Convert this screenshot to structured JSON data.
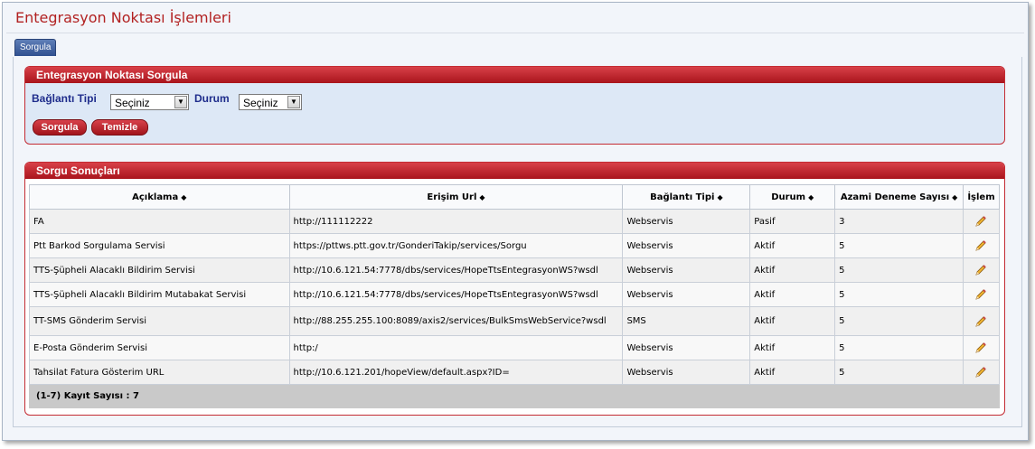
{
  "page": {
    "title": "Entegrasyon Noktası İşlemleri",
    "tab": "Sorgula"
  },
  "query_panel": {
    "header": "Entegrasyon Noktası Sorgula",
    "connection_type": {
      "label": "Bağlantı Tipi",
      "value": "Seçiniz"
    },
    "status": {
      "label": "Durum",
      "value": "Seçiniz"
    },
    "search_button": "Sorgula",
    "clear_button": "Temizle"
  },
  "results_panel": {
    "header": "Sorgu Sonuçları",
    "columns": [
      "Açıklama",
      "Erişim Url",
      "Bağlantı Tipi",
      "Durum",
      "Azami Deneme Sayısı",
      "İşlem"
    ],
    "rows": [
      {
        "description": "FA",
        "url": "http://111112222",
        "type": "Webservis",
        "status": "Pasif",
        "attempts": "3"
      },
      {
        "description": "Ptt Barkod Sorgulama Servisi",
        "url": "https://pttws.ptt.gov.tr/GonderiTakip/services/Sorgu",
        "type": "Webservis",
        "status": "Aktif",
        "attempts": "5"
      },
      {
        "description": "TTS-Şüpheli Alacaklı Bildirim Servisi",
        "url": "http://10.6.121.54:7778/dbs/services/HopeTtsEntegrasyonWS?wsdl",
        "type": "Webservis",
        "status": "Aktif",
        "attempts": "5"
      },
      {
        "description": "TTS-Şüpheli Alacaklı Bildirim Mutabakat Servisi",
        "url": "http://10.6.121.54:7778/dbs/services/HopeTtsEntegrasyonWS?wsdl",
        "type": "Webservis",
        "status": "Aktif",
        "attempts": "5"
      },
      {
        "description": "TT-SMS Gönderim Servisi",
        "url": "http://88.255.255.100:8089/axis2/services/BulkSmsWebService?wsdl",
        "type": "SMS",
        "status": "Aktif",
        "attempts": "5"
      },
      {
        "description": "E-Posta Gönderim Servisi",
        "url": "http:/",
        "type": "Webservis",
        "status": "Aktif",
        "attempts": "5"
      },
      {
        "description": "Tahsilat Fatura Gösterim URL",
        "url": "http://10.6.121.201/hopeView/default.aspx?ID=",
        "type": "Webservis",
        "status": "Aktif",
        "attempts": "5"
      }
    ],
    "footer": "(1-7) Kayıt Sayısı : 7",
    "edit_icon": "pencil-icon",
    "sort_icon": "sort-arrows-icon"
  }
}
